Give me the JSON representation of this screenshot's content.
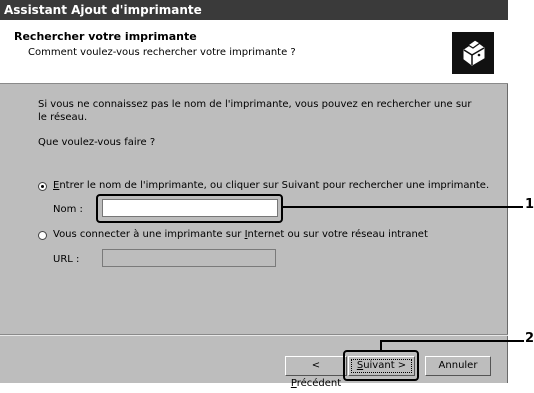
{
  "window": {
    "title": "Assistant Ajout d'imprimante"
  },
  "header": {
    "title": "Rechercher votre imprimante",
    "subtitle": "Comment voulez-vous rechercher votre imprimante ?",
    "icon": "printer-icon"
  },
  "body": {
    "intro_line1": "Si vous ne connaissez pas le nom de l'imprimante, vous pouvez en rechercher une sur",
    "intro_line2": "le réseau.",
    "question": "Que voulez-vous faire ?"
  },
  "options": [
    {
      "label_prefix": "E",
      "label_rest": "ntrer le nom de l'imprimante, ou cliquer sur Suivant pour rechercher une imprimante.",
      "selected": true
    },
    {
      "label_start": "Vous connecter à une imprimante sur ",
      "label_underlined": "I",
      "label_end": "nternet ou sur votre réseau intranet",
      "selected": false
    }
  ],
  "name_field": {
    "label": "Nom :",
    "value": ""
  },
  "url_field": {
    "label": "URL :",
    "value": ""
  },
  "buttons": {
    "back_prefix": "< ",
    "back_underlined": "P",
    "back_rest": "récédent",
    "next_underlined": "S",
    "next_rest": "uivant >",
    "cancel": "Annuler"
  },
  "callouts": {
    "one": "1",
    "two": "2"
  }
}
